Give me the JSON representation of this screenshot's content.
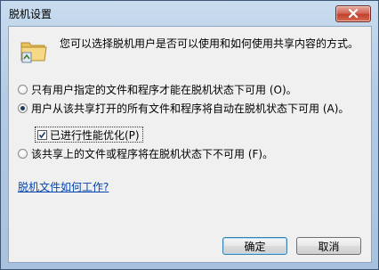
{
  "window": {
    "title": "脱机设置"
  },
  "description": "您可以选择脱机用户是否可以使用和如何使用共享内容的方式。",
  "options": [
    {
      "label": "只有用户指定的文件和程序才能在脱机状态下可用 (O)。",
      "checked": false
    },
    {
      "label": "用户从该共享打开的所有文件和程序将自动在脱机状态下可用 (A)。",
      "checked": true
    },
    {
      "label": "该共享上的文件或程序将在脱机状态下不可用 (F)。",
      "checked": false
    }
  ],
  "optimize_checkbox": {
    "label": "已进行性能优化(P)",
    "checked": true
  },
  "help_link": "脱机文件如何工作?",
  "buttons": {
    "ok": "确定",
    "cancel": "取消"
  },
  "icons": {
    "folder": "folder-offline-icon",
    "close": "close-icon"
  }
}
